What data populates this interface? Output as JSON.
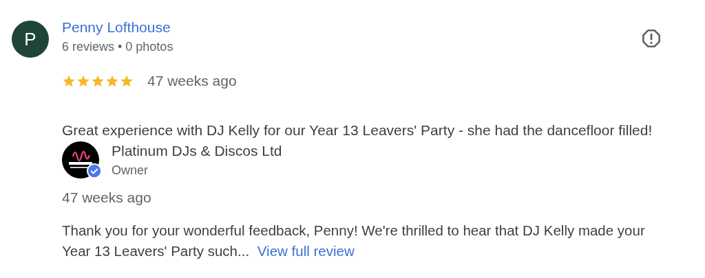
{
  "reviewer": {
    "initial": "P",
    "name": "Penny Lofthouse",
    "meta": "6 reviews • 0 photos"
  },
  "review": {
    "stars": 5,
    "time": "47 weeks ago",
    "text": "Great experience with DJ Kelly for our Year 13 Leavers' Party - she had the dancefloor filled!"
  },
  "owner_reply": {
    "name": "Platinum DJs & Discos Ltd",
    "role": "Owner",
    "verified": true,
    "time": "47 weeks ago",
    "text": "Thank you for your wonderful feedback, Penny! We're thrilled to hear that DJ Kelly made your Year 13 Leavers' Party such...",
    "link": "View full review"
  }
}
